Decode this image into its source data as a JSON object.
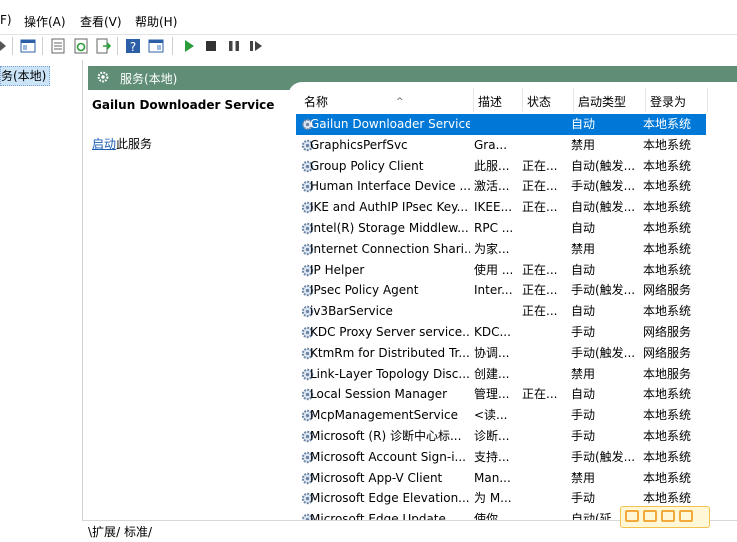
{
  "menu": {
    "file_tail": "F)",
    "action": "操作(A)",
    "view": "查看(V)",
    "help": "帮助(H)"
  },
  "tree": {
    "selected_item": "务(本地)"
  },
  "header": {
    "title": "服务(本地)"
  },
  "detail": {
    "service_name": "Gailun Downloader Service",
    "start_link": "启动",
    "start_suffix": "此服务"
  },
  "columns": {
    "name": "名称",
    "desc": "描述",
    "status": "状态",
    "startup": "启动类型",
    "logon": "登录为"
  },
  "services": [
    {
      "name": "Gailun Downloader Service",
      "desc": "",
      "status": "",
      "startup": "自动",
      "logon": "本地系统",
      "selected": true
    },
    {
      "name": "GraphicsPerfSvc",
      "desc": "Gra...",
      "status": "",
      "startup": "禁用",
      "logon": "本地系统"
    },
    {
      "name": "Group Policy Client",
      "desc": "此服...",
      "status": "正在...",
      "startup": "自动(触发...",
      "logon": "本地系统"
    },
    {
      "name": "Human Interface Device ...",
      "desc": "激活...",
      "status": "正在...",
      "startup": "手动(触发...",
      "logon": "本地系统"
    },
    {
      "name": "IKE and AuthIP IPsec Key...",
      "desc": "IKEE...",
      "status": "正在...",
      "startup": "自动(触发...",
      "logon": "本地系统"
    },
    {
      "name": "Intel(R) Storage Middlew...",
      "desc": "RPC ...",
      "status": "",
      "startup": "自动",
      "logon": "本地系统"
    },
    {
      "name": "Internet Connection Shari...",
      "desc": "为家...",
      "status": "",
      "startup": "禁用",
      "logon": "本地系统"
    },
    {
      "name": "IP Helper",
      "desc": "使用 ...",
      "status": "正在...",
      "startup": "自动",
      "logon": "本地系统"
    },
    {
      "name": "IPsec Policy Agent",
      "desc": "Inter...",
      "status": "正在...",
      "startup": "手动(触发...",
      "logon": "网络服务"
    },
    {
      "name": "iv3BarService",
      "desc": "",
      "status": "正在...",
      "startup": "自动",
      "logon": "本地系统"
    },
    {
      "name": "KDC Proxy Server service...",
      "desc": "KDC...",
      "status": "",
      "startup": "手动",
      "logon": "网络服务"
    },
    {
      "name": "KtmRm for Distributed Tr...",
      "desc": "协调...",
      "status": "",
      "startup": "手动(触发...",
      "logon": "网络服务"
    },
    {
      "name": "Link-Layer Topology Disc...",
      "desc": "创建...",
      "status": "",
      "startup": "禁用",
      "logon": "本地服务"
    },
    {
      "name": "Local Session Manager",
      "desc": "管理...",
      "status": "正在...",
      "startup": "自动",
      "logon": "本地系统"
    },
    {
      "name": "McpManagementService",
      "desc": "<读...",
      "status": "",
      "startup": "手动",
      "logon": "本地系统"
    },
    {
      "name": "Microsoft (R) 诊断中心标...",
      "desc": "诊断...",
      "status": "",
      "startup": "手动",
      "logon": "本地系统"
    },
    {
      "name": "Microsoft Account Sign-i...",
      "desc": "支持...",
      "status": "",
      "startup": "手动(触发...",
      "logon": "本地系统"
    },
    {
      "name": "Microsoft App-V Client",
      "desc": "Man...",
      "status": "",
      "startup": "禁用",
      "logon": "本地系统"
    },
    {
      "name": "Microsoft Edge Elevation...",
      "desc": "为 M...",
      "status": "",
      "startup": "手动",
      "logon": "本地系统"
    },
    {
      "name": "Microsoft Edge Update ...",
      "desc": "使你...",
      "status": "",
      "startup": "自动(延...",
      "logon": "本地系统"
    }
  ],
  "tabs": {
    "extended": "扩展",
    "standard": "标准"
  },
  "colors": {
    "header_band": "#5f8d75",
    "selection": "#0078d7",
    "link": "#1a5db4"
  }
}
